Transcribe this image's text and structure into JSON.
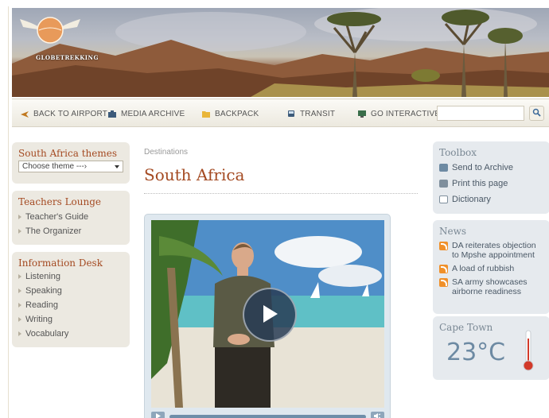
{
  "header": {
    "logo_text": "GLOBETREKKING"
  },
  "nav": {
    "items": [
      {
        "label": "BACK TO AIRPORT",
        "icon": "airplane-icon"
      },
      {
        "label": "MEDIA ARCHIVE",
        "icon": "camera-icon"
      },
      {
        "label": "BACKPACK",
        "icon": "folder-icon"
      },
      {
        "label": "TRANSIT",
        "icon": "transit-icon"
      },
      {
        "label": "GO INTERACTIVE",
        "icon": "computer-icon"
      }
    ],
    "search_value": ""
  },
  "left": {
    "themes": {
      "title": "South Africa themes",
      "select_value": "Choose theme ---›"
    },
    "teachers": {
      "title": "Teachers Lounge",
      "items": [
        "Teacher's Guide",
        "The Organizer"
      ]
    },
    "info": {
      "title": "Information Desk",
      "items": [
        "Listening",
        "Speaking",
        "Reading",
        "Writing",
        "Vocabulary"
      ]
    }
  },
  "main": {
    "breadcrumb": "Destinations",
    "title": "South Africa"
  },
  "right": {
    "toolbox": {
      "title": "Toolbox",
      "items": [
        "Send to Archive",
        "Print this page",
        "Dictionary"
      ]
    },
    "news": {
      "title": "News",
      "items": [
        "DA reiterates objection to Mpshe appointment",
        "A load of rubbish",
        "SA army showcases airborne readiness"
      ]
    },
    "weather": {
      "city": "Cape Town",
      "temp": "23°C"
    }
  },
  "colors": {
    "accent": "#a44a22",
    "right_accent": "#6d8aa3"
  }
}
